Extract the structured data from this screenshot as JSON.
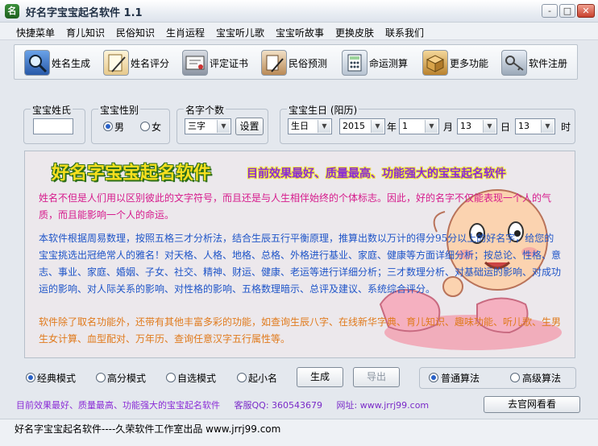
{
  "window": {
    "logo_char": "名",
    "title": "好名字宝宝起名软件 1.1",
    "min_label": "-",
    "max_label": "□",
    "close_label": "✕"
  },
  "menu": {
    "items": [
      "快捷菜单",
      "育儿知识",
      "民俗知识",
      "生肖运程",
      "宝宝听儿歌",
      "宝宝听故事",
      "更换皮肤",
      "联系我们"
    ]
  },
  "toolbar": {
    "items": [
      {
        "label": "姓名生成",
        "icon": "magnifier-icon"
      },
      {
        "label": "姓名评分",
        "icon": "scroll-pen-icon"
      },
      {
        "label": "评定证书",
        "icon": "certificate-icon"
      },
      {
        "label": "民俗预测",
        "icon": "folklore-icon"
      },
      {
        "label": "命运测算",
        "icon": "calculator-icon"
      },
      {
        "label": "更多功能",
        "icon": "box-icon"
      },
      {
        "label": "软件注册",
        "icon": "key-icon"
      }
    ]
  },
  "form": {
    "surname": {
      "label": "宝宝姓氏",
      "value": ""
    },
    "gender": {
      "label": "宝宝性别",
      "options": [
        "男",
        "女"
      ],
      "selected": "男"
    },
    "name_length": {
      "label": "名字个数",
      "value": "三字",
      "set_label": "设置"
    },
    "birthday": {
      "label": "宝宝生日 (阳历)",
      "calendar": "生日",
      "year": "2015",
      "year_unit": "年",
      "month": "1",
      "month_unit": "月",
      "day": "13",
      "day_unit": "日",
      "hour": "13",
      "hour_unit": "时"
    }
  },
  "intro": {
    "banner_title": "好名字宝宝起名软件",
    "banner_slogan": "目前效果最好、质量最高、功能强大的宝宝起名软件",
    "para1": "姓名不但是人们用以区别彼此的文字符号，而且还是与人生相伴始终的个体标志。因此，好的名字不仅能表现一个人的气质，而且能影响一个人的命运。",
    "para2": "本软件根据周易数理，按照五格三才分析法，结合生辰五行平衡原理，推算出数以万计的得分95分以上的好名字，给您的宝宝挑选出冠绝常人的雅名！对天格、人格、地格、总格、外格进行基业、家庭、健康等方面详细分析；按总论、性格、意志、事业、家庭、婚姻、子女、社交、精神、财运、健康、老运等进行详细分析；三才数理分析、对基础运的影响、对成功运的影响、对人际关系的影响、对性格的影响、五格数理暗示、总评及建议、系统综合评分。",
    "para3": "软件除了取名功能外，还带有其他丰富多彩的功能，如查询生辰八字、在线新华字典、育儿知识、趣味功能、听儿歌、生男生女计算、血型配对、万年历、查询任意汉字五行属性等。"
  },
  "modes": {
    "options": [
      "经典模式",
      "高分模式",
      "自选模式",
      "起小名"
    ],
    "selected": "经典模式",
    "generate_label": "生成",
    "export_label": "导出",
    "algorithms": [
      "普通算法",
      "高级算法"
    ],
    "selected_algorithm": "普通算法"
  },
  "footer": {
    "slogan": "目前效果最好、质量最高、功能强大的宝宝起名软件",
    "qq_label": "客服QQ: 360543679",
    "site_label": "网址: www.jrrj99.com",
    "visit_label": "去官网看看"
  },
  "status": {
    "text": "好名字宝宝起名软件----久荣软件工作室出品   www.jrrj99.com"
  },
  "colors": {
    "accent": "#2a62c8",
    "pink_text": "#d61a8c",
    "blue_text": "#1f55c8",
    "orange_text": "#e07a1c",
    "footer_purple": "#8a2bd6"
  }
}
